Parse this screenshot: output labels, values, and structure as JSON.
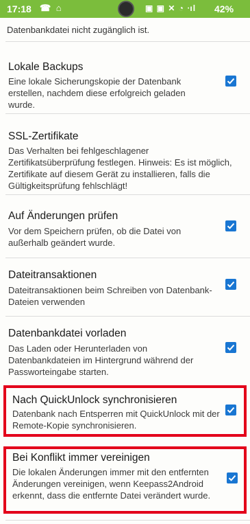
{
  "status_bar": {
    "time": "17:18",
    "battery": "42%"
  },
  "top_fragment": "Datenbankdatei nicht zugänglich ist.",
  "settings": [
    {
      "title": "Lokale Backups",
      "summary": "Eine lokale Sicherungskopie der Datenbank erstellen, nachdem diese erfolgreich geladen wurde.",
      "checked": true
    },
    {
      "title": "SSL-Zertifikate",
      "summary": "Das Verhalten bei fehlgeschlagener Zertifikatsüberprüfung festlegen. Hinweis: Es ist möglich, Zertifikate auf diesem Gerät zu installieren, falls die Gültigkeitsprüfung fehlschlägt!",
      "checked": null
    },
    {
      "title": "Auf Änderungen prüfen",
      "summary": "Vor dem Speichern prüfen, ob die Datei von außerhalb geändert wurde.",
      "checked": true
    },
    {
      "title": "Dateitransaktionen",
      "summary": "Dateitransaktionen beim Schreiben von Datenbank-Dateien verwenden",
      "checked": true
    },
    {
      "title": "Datenbankdatei vorladen",
      "summary": "Das Laden oder Herunterladen von Datenbankdateien im Hintergrund während der Passworteingabe starten.",
      "checked": true
    },
    {
      "title": "Nach QuickUnlock synchronisieren",
      "summary": "Datenbank nach Entsperren mit QuickUnlock mit der Remote-Kopie synchronisieren.",
      "checked": true
    },
    {
      "title": "Bei Konflikt immer vereinigen",
      "summary": "Die lokalen Änderungen immer mit den entfernten Änderungen vereinigen, wenn Keepass2Android erkennt, dass die entfernte Datei verändert wurde.",
      "checked": true
    }
  ],
  "colors": {
    "status_bar": "#7bbd3c",
    "checkbox": "#1976d2",
    "highlight": "#e3001a"
  }
}
